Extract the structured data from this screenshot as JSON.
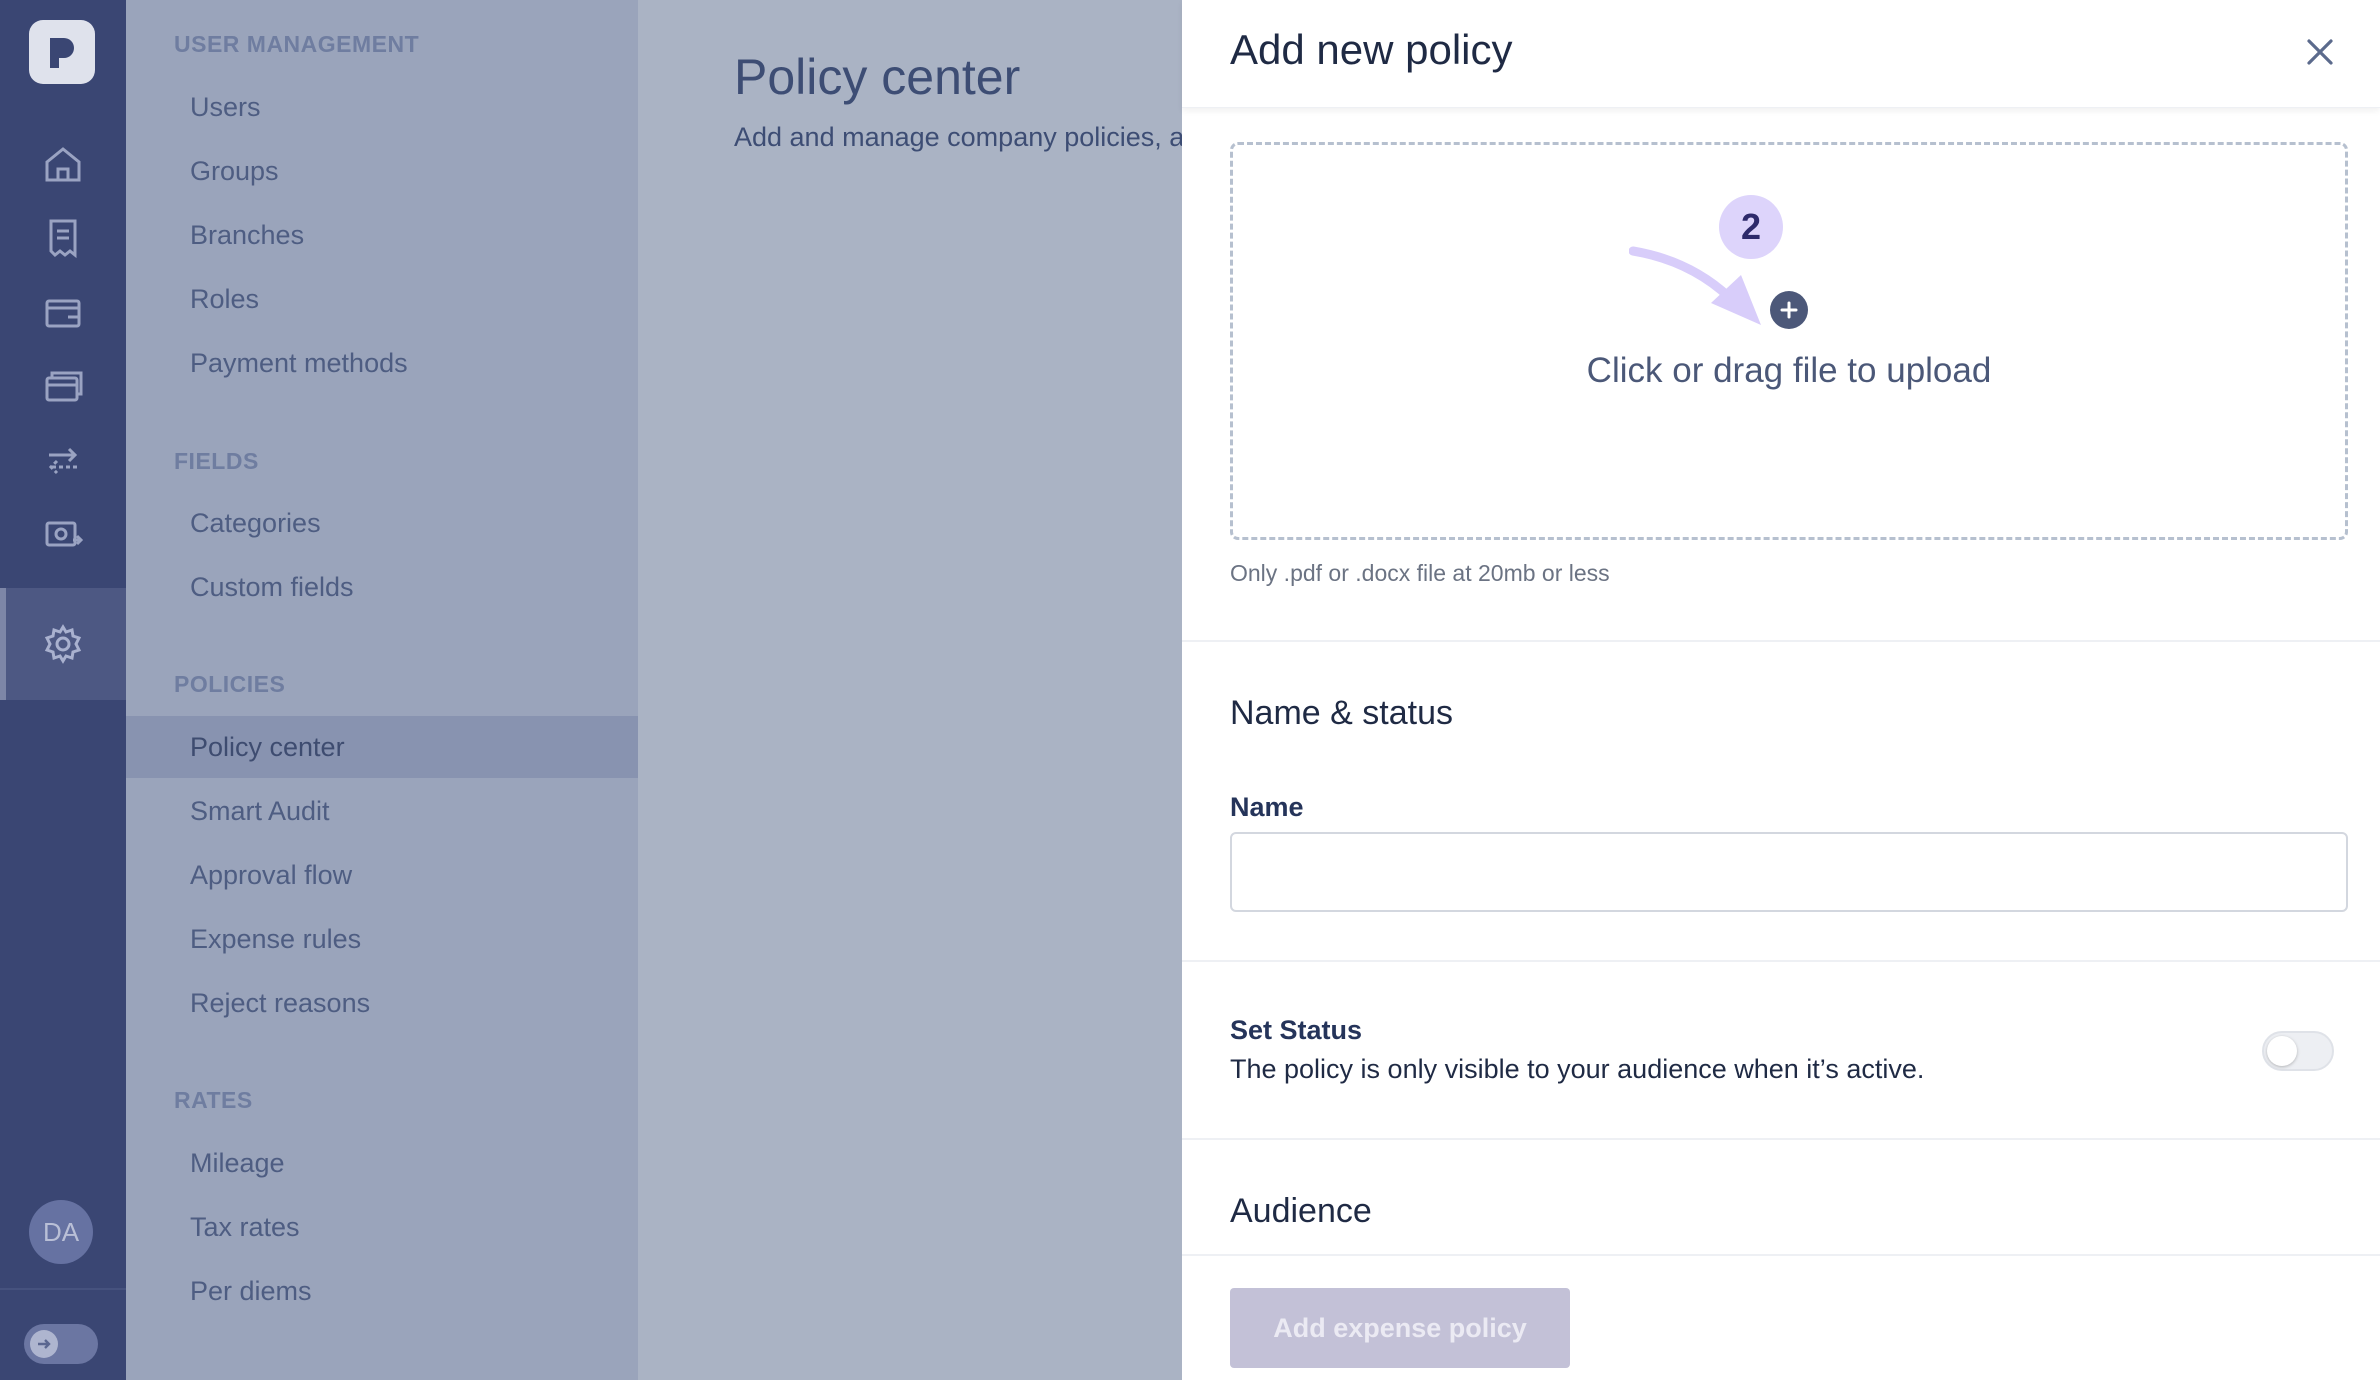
{
  "rail": {
    "icons": [
      "logo-icon",
      "home-icon",
      "receipt-icon",
      "wallet-icon",
      "cards-icon",
      "transfer-icon",
      "reimbursement-icon",
      "reports-icon",
      "settings-icon"
    ],
    "avatar_initials": "DA",
    "active_icon": "settings-icon"
  },
  "nav": {
    "sections": [
      {
        "title": "USER MANAGEMENT",
        "items": [
          "Users",
          "Groups",
          "Branches",
          "Roles",
          "Payment methods"
        ]
      },
      {
        "title": "FIELDS",
        "items": [
          "Categories",
          "Custom fields"
        ]
      },
      {
        "title": "POLICIES",
        "items": [
          "Policy center",
          "Smart Audit",
          "Approval flow",
          "Expense rules",
          "Reject reasons"
        ]
      },
      {
        "title": "RATES",
        "items": [
          "Mileage",
          "Tax rates",
          "Per diems"
        ]
      }
    ],
    "active_item": "Policy center"
  },
  "main": {
    "title": "Policy center",
    "subtitle": "Add and manage company policies, a"
  },
  "drawer": {
    "title": "Add new policy",
    "upload": {
      "step_number": "2",
      "text": "Click or drag file to upload",
      "hint": "Only .pdf or .docx file at 20mb or less"
    },
    "name_status": {
      "heading": "Name & status",
      "name_label": "Name",
      "name_value": "",
      "name_placeholder": "",
      "status_label": "Set Status",
      "status_description": "The policy is only visible to your audience when it’s active.",
      "status_active": false
    },
    "audience": {
      "heading": "Audience"
    },
    "submit_label": "Add expense policy"
  },
  "colors": {
    "rail": "#3a4673",
    "nav_overlay": "#9aa4bb",
    "step_badge": "#ddd4fb",
    "button_disabled": "#c3c1d7"
  }
}
